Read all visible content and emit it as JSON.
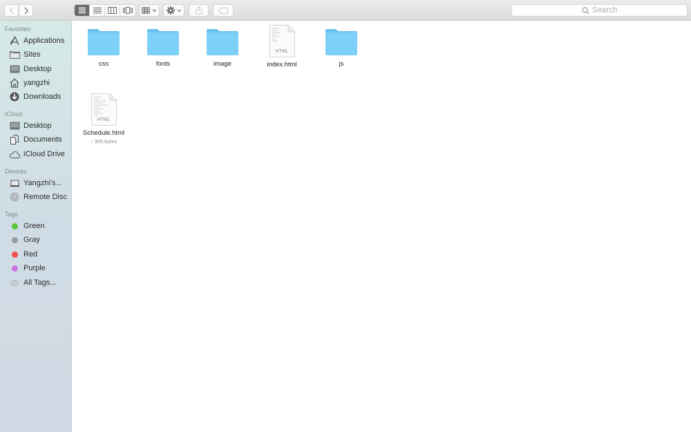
{
  "toolbar": {
    "back_icon": "chevron-left-icon",
    "forward_icon": "chevron-right-icon",
    "view_modes": [
      {
        "name": "icon-view",
        "icon": "grid-icon",
        "active": true
      },
      {
        "name": "list-view",
        "icon": "list-icon",
        "active": false
      },
      {
        "name": "column-view",
        "icon": "columns-icon",
        "active": false
      },
      {
        "name": "gallery-view",
        "icon": "gallery-icon",
        "active": false
      }
    ],
    "group_icon": "group-grid-icon",
    "action_icon": "gear-icon",
    "share_icon": "share-icon",
    "tag_icon": "tag-icon",
    "search_placeholder": "Search"
  },
  "sidebar": {
    "sections": [
      {
        "title": "Favorites",
        "items": [
          {
            "label": "Applications",
            "icon": "applications-icon"
          },
          {
            "label": "Sites",
            "icon": "folder-icon"
          },
          {
            "label": "Desktop",
            "icon": "desktop-icon"
          },
          {
            "label": "yangzhi",
            "icon": "home-icon"
          },
          {
            "label": "Downloads",
            "icon": "downloads-icon"
          }
        ]
      },
      {
        "title": "iCloud",
        "items": [
          {
            "label": "Desktop",
            "icon": "desktop-icon"
          },
          {
            "label": "Documents",
            "icon": "documents-icon"
          },
          {
            "label": "iCloud Drive",
            "icon": "cloud-icon"
          }
        ]
      },
      {
        "title": "Devices",
        "items": [
          {
            "label": "Yangzhi's...",
            "icon": "laptop-icon"
          },
          {
            "label": "Remote Disc",
            "icon": "disc-icon"
          }
        ]
      },
      {
        "title": "Tags",
        "items": [
          {
            "label": "Green",
            "color": "#5ac83c"
          },
          {
            "label": "Gray",
            "color": "#9a9a9c"
          },
          {
            "label": "Red",
            "color": "#f2504b"
          },
          {
            "label": "Purple",
            "color": "#cc73e1"
          },
          {
            "label": "All Tags...",
            "color": "#c6ccd3"
          }
        ]
      }
    ]
  },
  "files": [
    {
      "name": "css",
      "type": "folder"
    },
    {
      "name": "fonts",
      "type": "folder"
    },
    {
      "name": "image",
      "type": "folder"
    },
    {
      "name": "index.html",
      "type": "html",
      "badge": "HTML"
    },
    {
      "name": "js",
      "type": "folder"
    },
    {
      "name": "Schedule.html",
      "type": "html",
      "badge": "HTML",
      "sub": "↑ 305 bytes"
    }
  ]
}
